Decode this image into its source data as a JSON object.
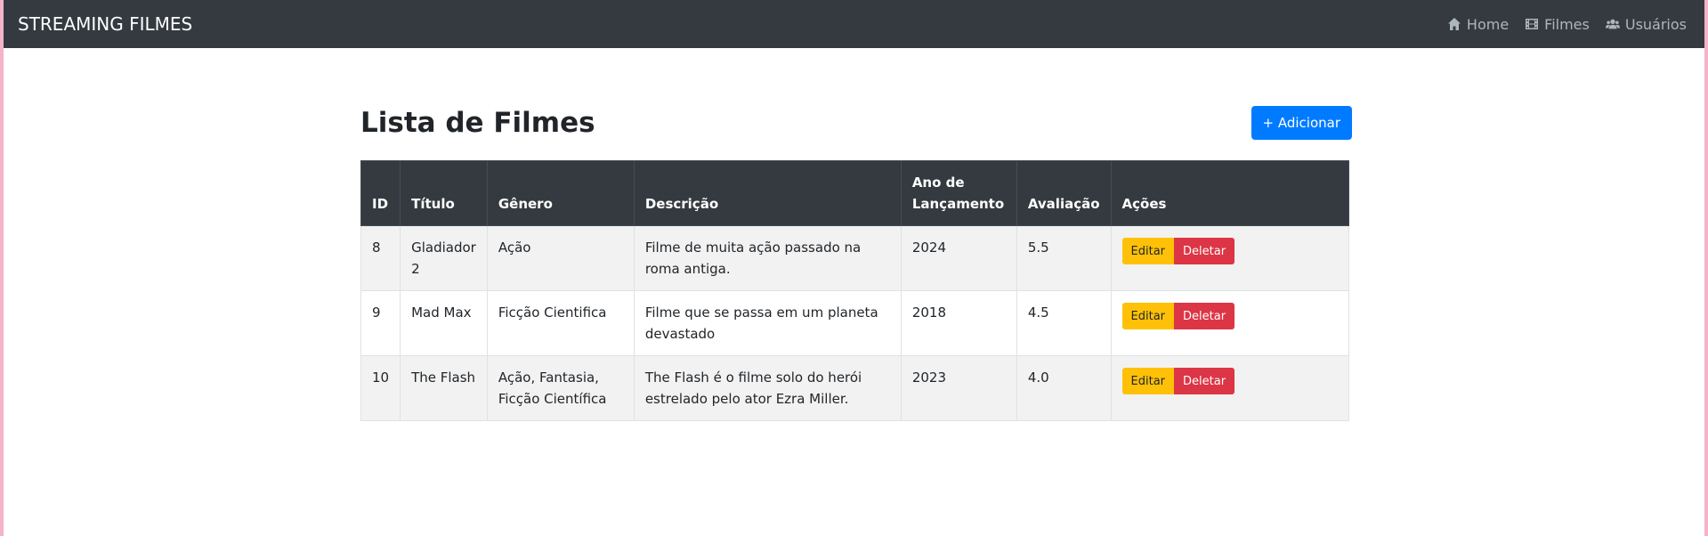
{
  "navbar": {
    "brand": "STREAMING FILMES",
    "links": [
      {
        "label": "Home",
        "icon": "home-icon"
      },
      {
        "label": "Filmes",
        "icon": "film-icon"
      },
      {
        "label": "Usuários",
        "icon": "users-icon"
      }
    ]
  },
  "main": {
    "title": "Lista de Filmes",
    "add_button": "+ Adicionar"
  },
  "table": {
    "headers": [
      "ID",
      "Título",
      "Gênero",
      "Descrição",
      "Ano de Lançamento",
      "Avaliação",
      "Ações"
    ],
    "rows": [
      {
        "id": "8",
        "titulo": "Gladiador 2",
        "genero": "Ação",
        "descricao": "Filme de muita ação passado na roma antiga.",
        "ano": "2024",
        "avaliacao": "5.5"
      },
      {
        "id": "9",
        "titulo": "Mad Max",
        "genero": "Ficção Cientifica",
        "descricao": "Filme que se passa em um planeta devastado",
        "ano": "2018",
        "avaliacao": "4.5"
      },
      {
        "id": "10",
        "titulo": "The Flash",
        "genero": "Ação, Fantasia, Ficção Científica",
        "descricao": "The Flash é o filme solo do herói estrelado pelo ator Ezra Miller.",
        "ano": "2023",
        "avaliacao": "4.0"
      }
    ],
    "edit_label": "Editar",
    "delete_label": "Deletar"
  },
  "colors": {
    "navbar": "#343a40",
    "primary": "#007bff",
    "warning": "#ffc107",
    "danger": "#dc3545"
  }
}
